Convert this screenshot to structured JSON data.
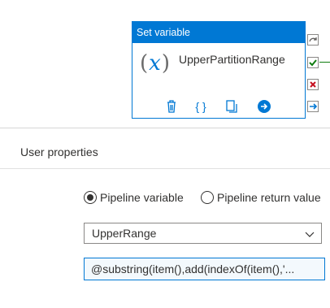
{
  "activity": {
    "header": "Set variable",
    "icon": "variable-icon",
    "icon_text": "x",
    "name": "UpperPartitionRange",
    "actions": [
      "delete-icon",
      "code-icon",
      "copy-icon",
      "navigate-icon"
    ],
    "side_connectors": [
      "skip-icon",
      "success-icon",
      "failure-icon",
      "completion-icon"
    ]
  },
  "properties": {
    "tab_label": "User properties",
    "variable_type": {
      "options": [
        {
          "label": "Pipeline variable",
          "checked": true
        },
        {
          "label": "Pipeline return value",
          "checked": false
        }
      ]
    },
    "variable_name": "UpperRange",
    "value": "@substring(item(),add(indexOf(item(),'..."
  },
  "colors": {
    "accent": "#0078d4",
    "success": "#107c10",
    "failure": "#c50f1f"
  }
}
